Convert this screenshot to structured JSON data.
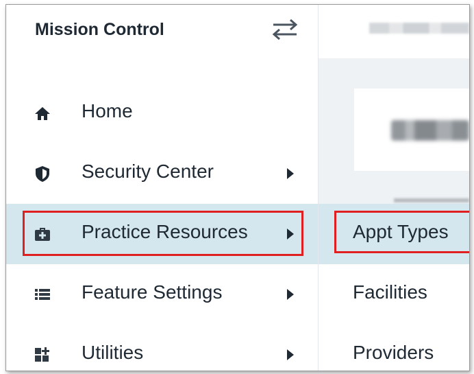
{
  "app": {
    "title": "Mission Control"
  },
  "sidebar": {
    "items": [
      {
        "label": "Home",
        "icon": "home-icon",
        "has_submenu": false
      },
      {
        "label": "Security Center",
        "icon": "shield-icon",
        "has_submenu": true
      },
      {
        "label": "Practice Resources",
        "icon": "medical-bag-icon",
        "has_submenu": true,
        "active": true
      },
      {
        "label": "Feature Settings",
        "icon": "list-icon",
        "has_submenu": true
      },
      {
        "label": "Utilities",
        "icon": "grid-plus-icon",
        "has_submenu": true
      }
    ]
  },
  "submenu": {
    "items": [
      {
        "label": "Appt Types",
        "active": true
      },
      {
        "label": "Facilities"
      },
      {
        "label": "Providers"
      }
    ]
  },
  "colors": {
    "active_bg": "#d4e7ee",
    "highlight": "#e02020",
    "text": "#1f2933",
    "content_band": "#eef2f5"
  }
}
